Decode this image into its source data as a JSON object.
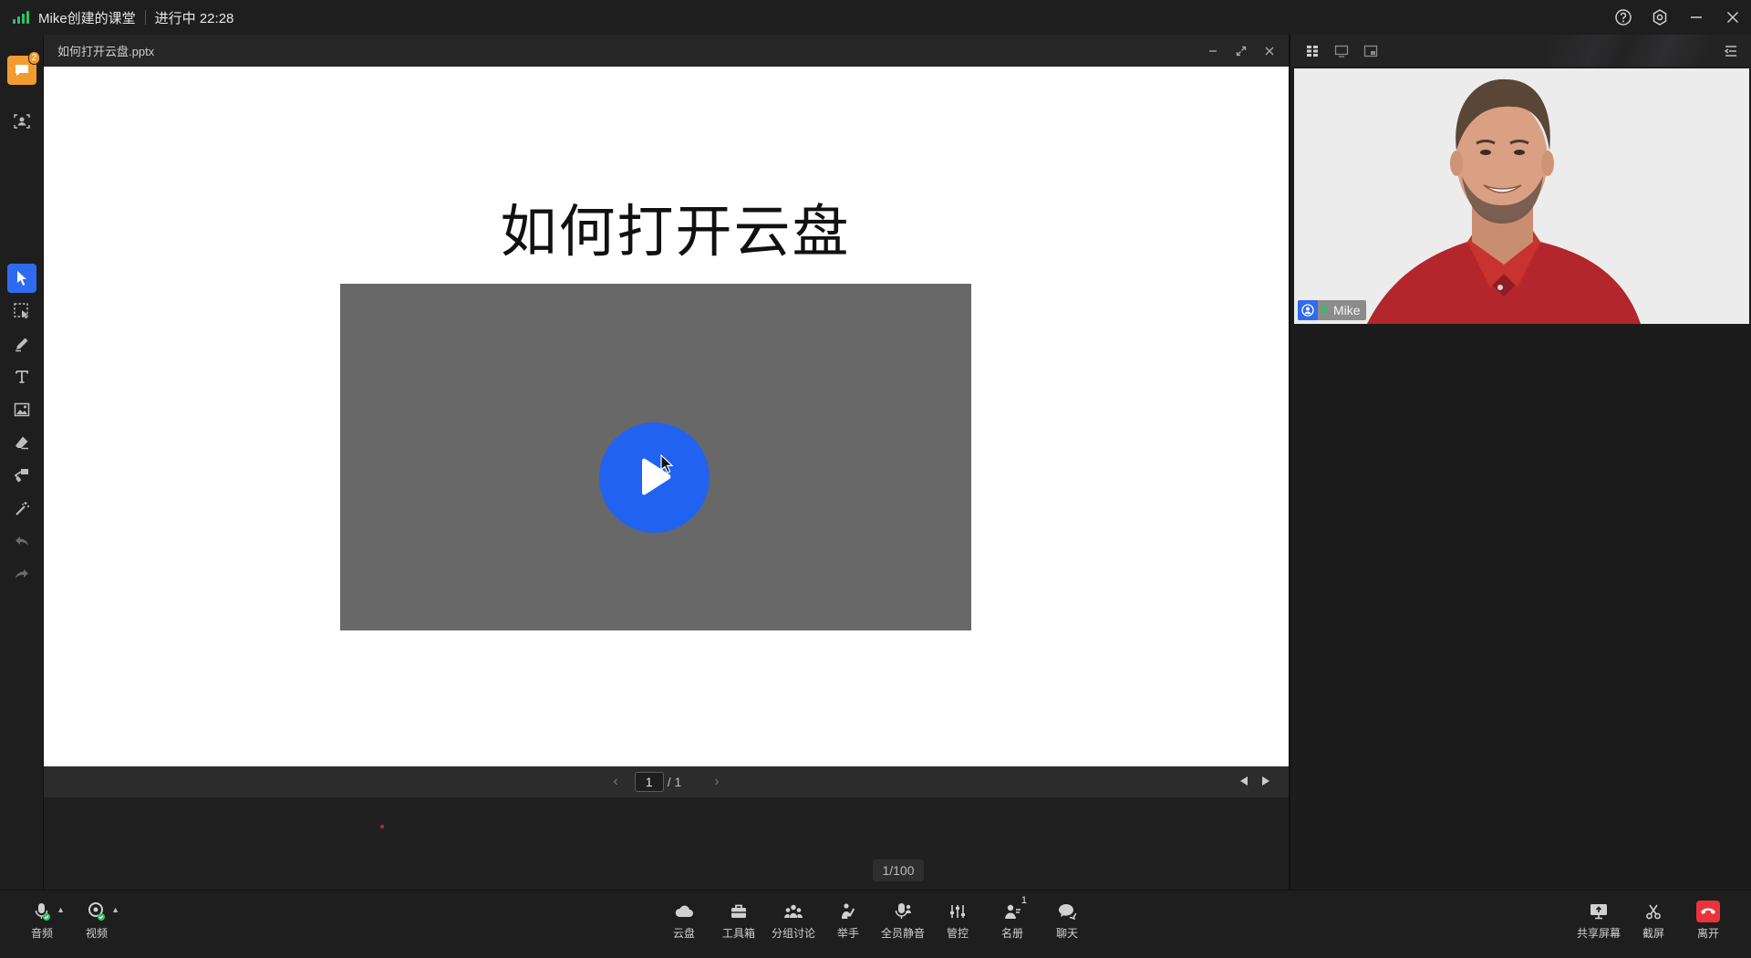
{
  "titlebar": {
    "room_name": "Mike创建的课堂",
    "status": "进行中 22:28",
    "buttons": [
      "help-icon",
      "settings-icon",
      "minimize-icon",
      "close-icon"
    ]
  },
  "leftbar": {
    "notification_badge": "2",
    "tools": [
      "select-tool",
      "area-select-tool",
      "pen-tool",
      "text-tool",
      "image-tool",
      "eraser-tool",
      "paint-tool",
      "laser-pointer-tool",
      "undo",
      "redo"
    ],
    "active_tool": "select-tool"
  },
  "document": {
    "filename": "如何打开云盘.pptx",
    "slide_title": "如何打开云盘",
    "current_page": "1",
    "total_pages": "/ 1",
    "page_counter": "1/100"
  },
  "participant": {
    "name": "Mike"
  },
  "bottombar": {
    "audio": "音频",
    "video": "视频",
    "cloud": "云盘",
    "toolbox": "工具箱",
    "breakout": "分组讨论",
    "raise_hand": "举手",
    "mute_all": "全员静音",
    "control": "管控",
    "roster": "名册",
    "roster_count": "1",
    "chat": "聊天",
    "share_screen": "共享屏幕",
    "screenshot": "截屏",
    "leave": "离开"
  },
  "colors": {
    "accent": "#2f6bf0",
    "play_button": "#2163f0",
    "video_placeholder": "#686868",
    "leave": "#e8343a",
    "signal": "#2fc264",
    "badge": "#f29b2f"
  }
}
